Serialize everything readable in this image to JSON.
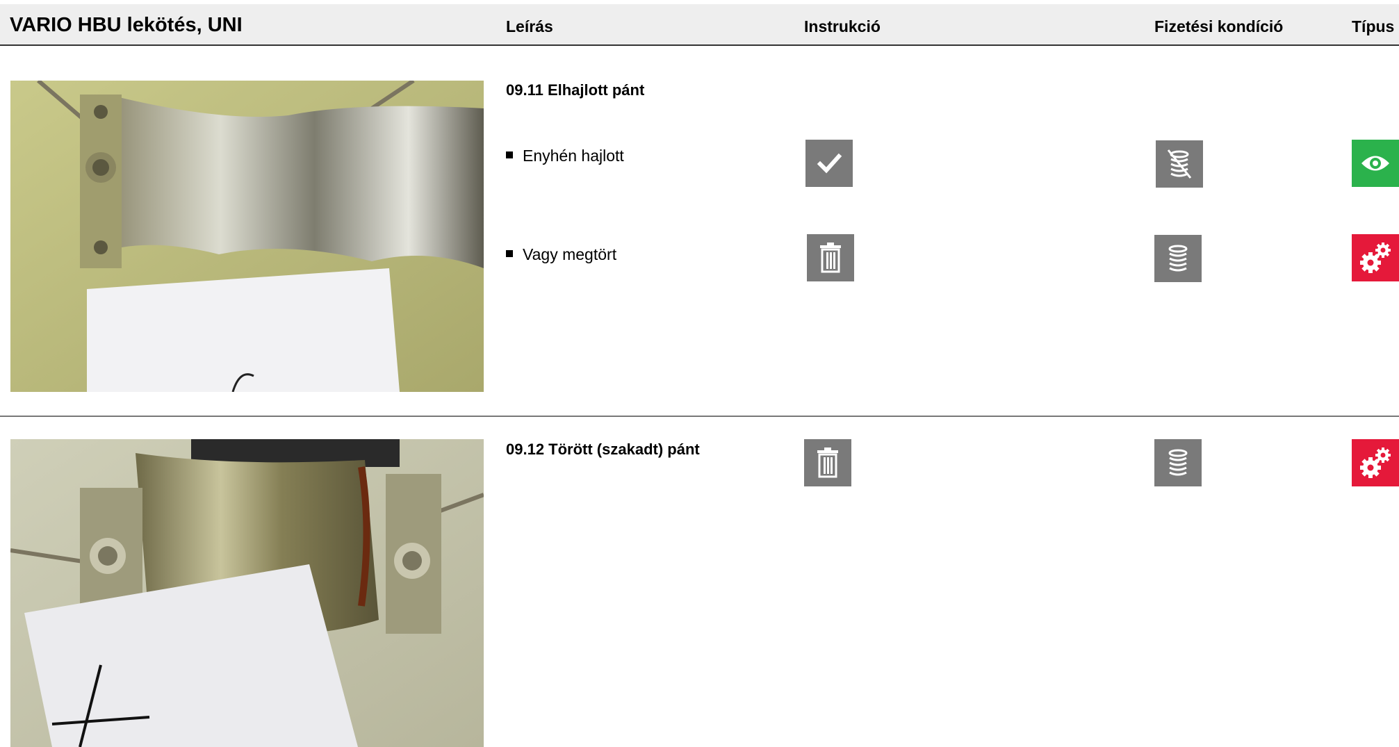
{
  "header": {
    "title": "VARIO HBU lekötés, UNI",
    "col_description": "Leírás",
    "col_instruction": "Instrukció",
    "col_payment": "Fizetési kondíció",
    "col_type": "Típus"
  },
  "sections": [
    {
      "title": "09.11 Elhajlott pánt",
      "items": [
        {
          "label": "Enyhén hajlott",
          "instruction_icon": "check-icon",
          "payment_icon": "coins-slashed-icon",
          "type_icon": "eye-icon",
          "type_color": "#2bb24c"
        },
        {
          "label": "Vagy megtört",
          "instruction_icon": "trash-icon",
          "payment_icon": "coins-icon",
          "type_icon": "gears-icon",
          "type_color": "#e5193a"
        }
      ]
    },
    {
      "title": "09.12 Törött (szakadt) pánt",
      "items": [
        {
          "label": "",
          "instruction_icon": "trash-icon",
          "payment_icon": "coins-icon",
          "type_icon": "gears-icon",
          "type_color": "#e5193a"
        }
      ]
    }
  ],
  "colors": {
    "header_bg": "#eeeeee",
    "icon_gray": "#7a7a7a",
    "green": "#2bb24c",
    "red": "#e5193a"
  }
}
